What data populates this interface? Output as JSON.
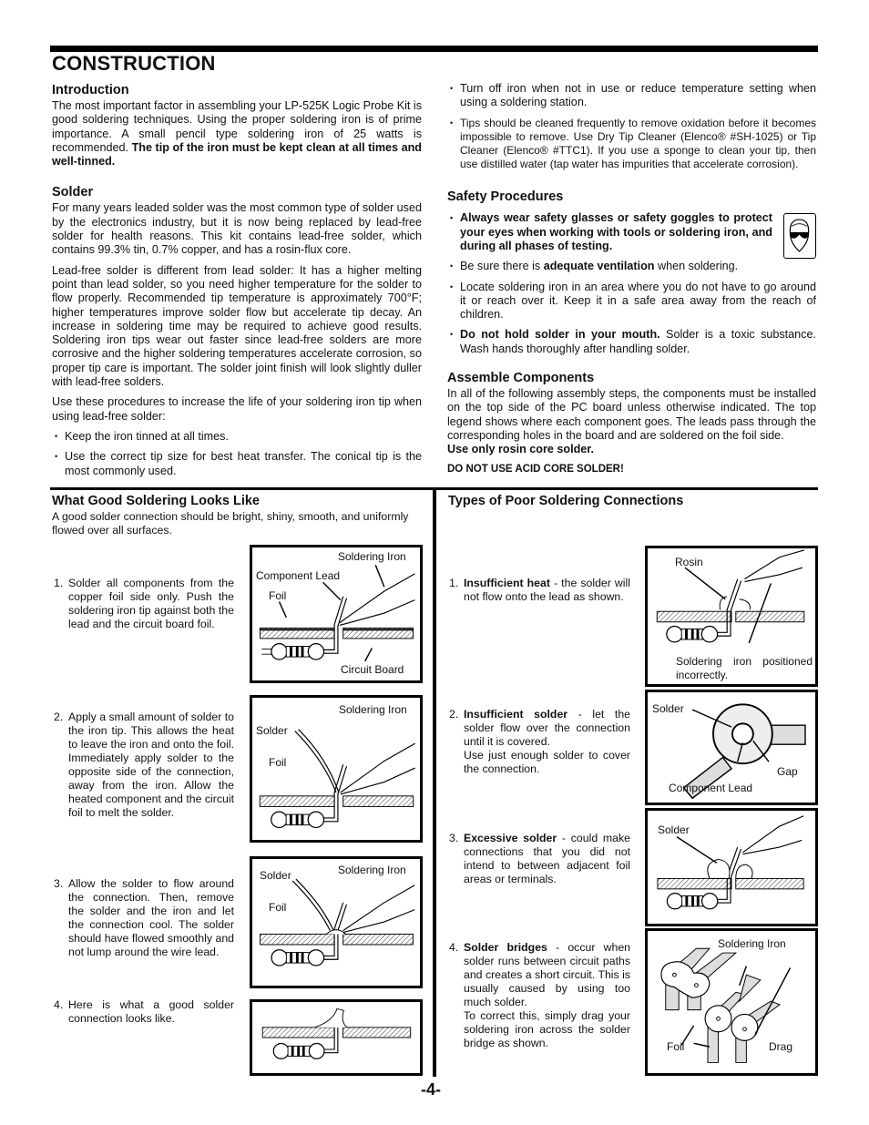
{
  "title": "CONSTRUCTION",
  "page_number": "-4-",
  "introduction": {
    "heading": "Introduction",
    "text": "The most important factor in assembling your LP-525K Logic Probe Kit is good soldering techniques. Using the proper soldering iron is of prime importance. A small pencil type soldering iron of 25 watts is recommended. ",
    "bold": "The tip of the iron must be kept clean at all times and well-tinned."
  },
  "solder": {
    "heading": "Solder",
    "p1": "For many years leaded solder was the most common type of solder used by the electronics industry, but it is now being replaced by lead-free solder for health reasons. This kit contains lead-free solder, which contains 99.3% tin, 0.7% copper, and has a rosin-flux core.",
    "p2": "Lead-free solder is different from lead solder: It has a higher melting point than lead solder, so you need higher temperature for the solder to flow properly. Recommended tip temperature is approximately 700°F; higher temperatures improve solder flow but accelerate tip decay. An increase in soldering time may be required to achieve good results. Soldering iron tips wear out faster since lead-free solders are more corrosive and the higher soldering temperatures accelerate corrosion, so proper tip care is important. The solder joint finish will look slightly duller with lead-free solders.",
    "p3": "Use these procedures to increase the life of your soldering iron tip when using lead-free solder:",
    "tips": [
      "Keep the iron tinned at all times.",
      "Use the correct tip size for best heat transfer. The conical tip is the most commonly used.",
      "Turn off iron when not in use or reduce temperature setting when using a soldering station.",
      "Tips should be cleaned frequently to remove oxidation before it becomes impossible to remove. Use Dry Tip Cleaner (Elenco® #SH-1025) or Tip Cleaner (Elenco® #TTC1). If you use a sponge to clean your tip, then use distilled water (tap water has impurities that accelerate corrosion)."
    ]
  },
  "safety": {
    "heading": "Safety Procedures",
    "item1_bold": "Always wear safety glasses or safety goggles to protect your eyes when working with tools or soldering iron, and during all phases of testing.",
    "item2_pre": "Be sure there is ",
    "item2_bold": "adequate ventilation",
    "item2_post": " when soldering.",
    "item3": "Locate soldering iron in an area where you do not have to go around it or reach over it. Keep it in a safe area away from the reach of children.",
    "item4_bold": "Do not hold solder in your mouth.",
    "item4_post": " Solder is a toxic substance. Wash hands thoroughly after handling solder.",
    "icon": "safety-glasses-icon"
  },
  "assemble": {
    "heading": "Assemble Components",
    "text": "In all of the following assembly steps, the components must be installed on the top side of the PC board unless otherwise indicated. The top legend shows where each component goes. The leads pass through the corresponding holes in the board and are soldered on the foil side.",
    "bold1": "Use only rosin core solder.",
    "bold2": "DO NOT USE ACID CORE SOLDER!"
  },
  "good": {
    "heading": "What Good Soldering Looks Like",
    "intro": "A good solder connection should be bright, shiny, smooth, and uniformly flowed over all surfaces.",
    "steps": [
      {
        "num": "1.",
        "text": "Solder all components from the copper foil side only.  Push the soldering iron tip against both the lead and the circuit board foil.",
        "labels": [
          "Soldering Iron",
          "Component Lead",
          "Foil",
          "Circuit Board"
        ]
      },
      {
        "num": "2.",
        "text": "Apply a small amount of solder to the iron tip. This allows the heat to leave the iron and onto the foil. Immediately apply solder to the opposite side of the connection, away from the iron. Allow the heated component and the circuit foil to melt the solder.",
        "labels": [
          "Soldering Iron",
          "Solder",
          "Foil"
        ]
      },
      {
        "num": "3.",
        "text": "Allow the solder to flow around the connection.  Then, remove the solder and the iron and let the connection cool. The solder should have flowed smoothly and not lump around the wire lead.",
        "labels": [
          "Solder",
          "Soldering Iron",
          "Foil"
        ]
      },
      {
        "num": "4.",
        "text": "Here is what a good solder connection looks like.",
        "labels": []
      }
    ]
  },
  "poor": {
    "heading": "Types of Poor Soldering Connections",
    "steps": [
      {
        "num": "1.",
        "bold": "Insufficient heat",
        "text": " - the solder will not flow onto the lead as shown.",
        "labels": [
          "Rosin",
          "Soldering iron positioned incorrectly."
        ]
      },
      {
        "num": "2.",
        "bold": "Insufficient solder",
        "text": " - let the solder flow over the connection until it is covered.",
        "text2": "Use just enough solder to cover the connection.",
        "labels": [
          "Solder",
          "Gap",
          "Component Lead"
        ]
      },
      {
        "num": "3.",
        "bold": "Excessive solder",
        "text": " - could make connections that you did not intend to between adjacent foil areas or terminals.",
        "labels": [
          "Solder"
        ]
      },
      {
        "num": "4.",
        "bold": "Solder bridges",
        "text": " - occur when solder runs between circuit paths and creates a short circuit. This is usually caused by using too much solder.",
        "text2": "To correct this, simply drag your soldering iron across the solder bridge as shown.",
        "labels": [
          "Soldering Iron",
          "Foil",
          "Drag"
        ]
      }
    ]
  }
}
